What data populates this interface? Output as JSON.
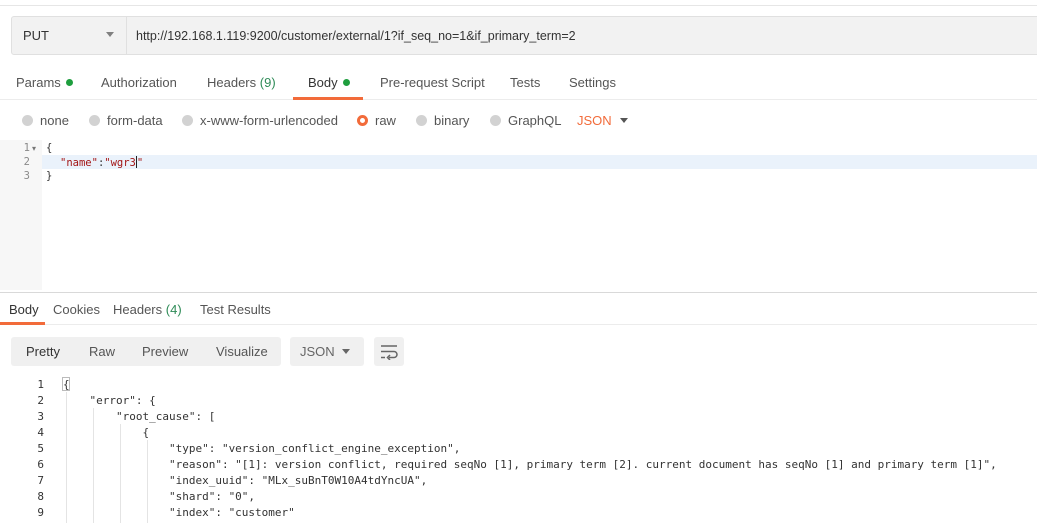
{
  "request": {
    "method": "PUT",
    "url": "http://192.168.1.119:9200/customer/external/1?if_seq_no=1&if_primary_term=2"
  },
  "request_tabs": [
    {
      "label": "Params",
      "count": ""
    },
    {
      "label": "Authorization",
      "count": ""
    },
    {
      "label": "Headers",
      "count": "(9)"
    },
    {
      "label": "Body",
      "count": ""
    },
    {
      "label": "Pre-request Script",
      "count": ""
    },
    {
      "label": "Tests",
      "count": ""
    },
    {
      "label": "Settings",
      "count": ""
    }
  ],
  "active_request_tab": "Body",
  "body_types": [
    "none",
    "form-data",
    "x-www-form-urlencoded",
    "raw",
    "binary",
    "GraphQL"
  ],
  "selected_body_type": "raw",
  "body_format": "JSON",
  "editor": {
    "line_numbers": [
      "1",
      "2",
      "3"
    ],
    "lines": [
      "{",
      "  \"name\":\"wgr3\"",
      "}"
    ],
    "key": "\"name\"",
    "colon": ":",
    "value": "\"wgr3",
    "value_end": "\""
  },
  "response_tabs": [
    {
      "label": "Body",
      "count": ""
    },
    {
      "label": "Cookies",
      "count": ""
    },
    {
      "label": "Headers",
      "count": "(4)"
    },
    {
      "label": "Test Results",
      "count": ""
    }
  ],
  "active_response_tab": "Body",
  "view_modes": [
    "Pretty",
    "Raw",
    "Preview",
    "Visualize"
  ],
  "response_format": "JSON",
  "response": {
    "line_numbers": [
      "1",
      "2",
      "3",
      "4",
      "5",
      "6",
      "7",
      "8",
      "9"
    ],
    "lines": [
      "{",
      "    \"error\": {",
      "        \"root_cause\": [",
      "            {",
      "                \"type\": \"version_conflict_engine_exception\",",
      "                \"reason\": \"[1]: version conflict, required seqNo [1], primary term [2]. current document has seqNo [1] and primary term [1]\",",
      "                \"index_uuid\": \"MLx_suBnT0W10A4tdYncUA\",",
      "                \"shard\": \"0\",",
      "                \"index\": \"customer\""
    ]
  },
  "colors": {
    "accent": "#f26b3a",
    "status_dot": "#1e9e3e",
    "count_text": "#2e8b57"
  }
}
